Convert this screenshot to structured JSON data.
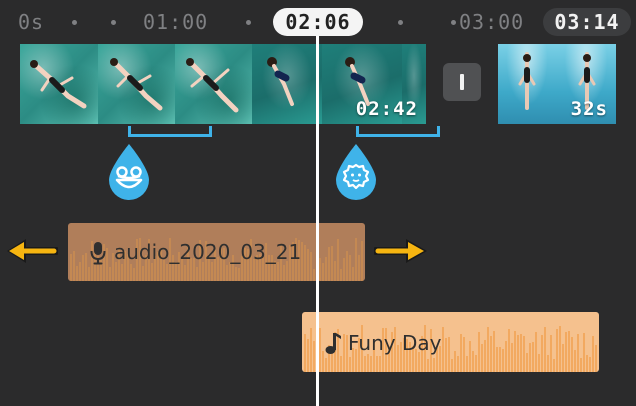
{
  "ruler": {
    "labels": [
      "0s",
      "01:00",
      "03:00"
    ],
    "playhead_time": "02:06",
    "total_duration": "03:14"
  },
  "video_track": {
    "clips": [
      {
        "name": "floating-clip",
        "duration": ""
      },
      {
        "name": "diving-clip",
        "duration": "02:42"
      },
      {
        "name": "underwater-clip",
        "duration": "32s"
      }
    ],
    "effects": [
      "frog-effect",
      "lion-effect"
    ]
  },
  "audio_tracks": [
    {
      "label": "audio_2020_03_21",
      "icon": "microphone-icon",
      "color": "#b07e5a"
    },
    {
      "label": "Funy Day",
      "icon": "music-note-icon",
      "color": "#f5c18e"
    }
  ],
  "colors": {
    "background": "#2b2b2c",
    "effect_accent": "#3fb3e9",
    "arrow_accent": "#f6b511",
    "playhead": "#ffffff"
  }
}
